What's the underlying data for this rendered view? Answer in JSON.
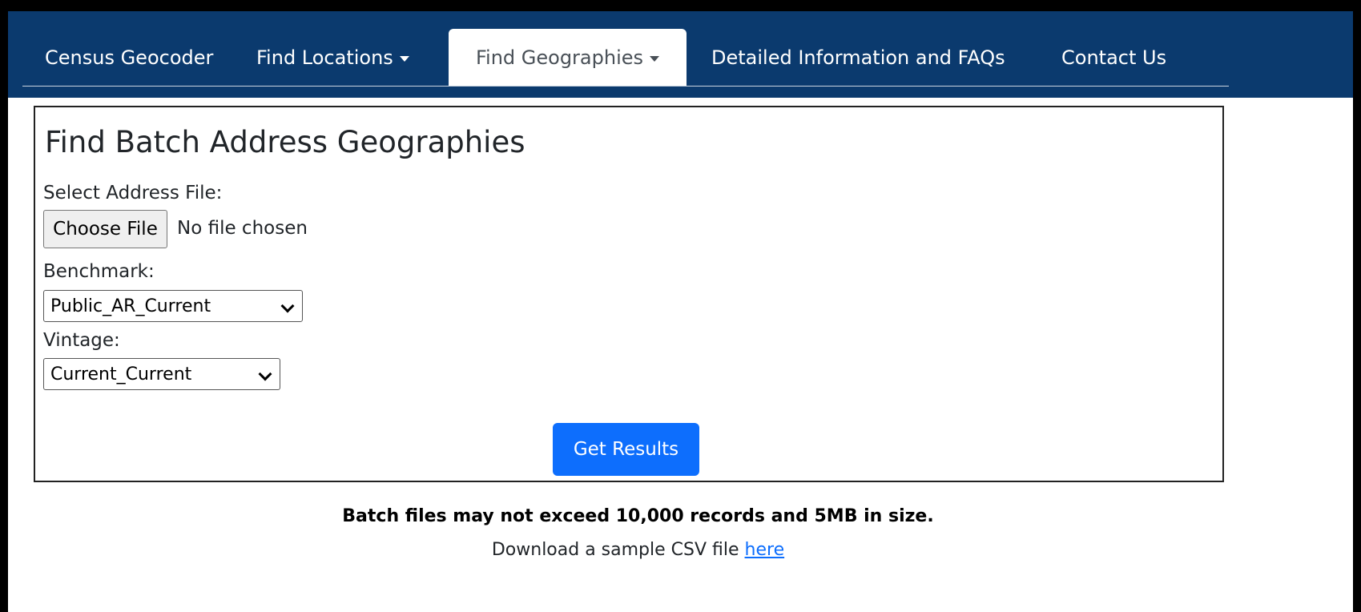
{
  "nav": {
    "items": [
      {
        "label": "Census Geocoder"
      },
      {
        "label": "Find Locations"
      },
      {
        "label": "Find Geographies"
      },
      {
        "label": "Detailed Information and FAQs"
      },
      {
        "label": "Contact Us"
      }
    ],
    "active": "Find Geographies"
  },
  "form": {
    "title": "Find Batch Address Geographies",
    "file_label": "Select Address File:",
    "file_button": "Choose File",
    "file_status": "No file chosen",
    "benchmark_label": "Benchmark:",
    "benchmark_value": "Public_AR_Current",
    "vintage_label": "Vintage:",
    "vintage_value": "Current_Current",
    "submit_label": "Get Results"
  },
  "footer": {
    "notice": "Batch files may not exceed 10,000 records and 5MB in size.",
    "sample_text": "Download a sample CSV file",
    "sample_link": "here"
  },
  "colors": {
    "navbar": "#0b3a6e",
    "primary": "#0d6efd",
    "link": "#0d6efd"
  }
}
